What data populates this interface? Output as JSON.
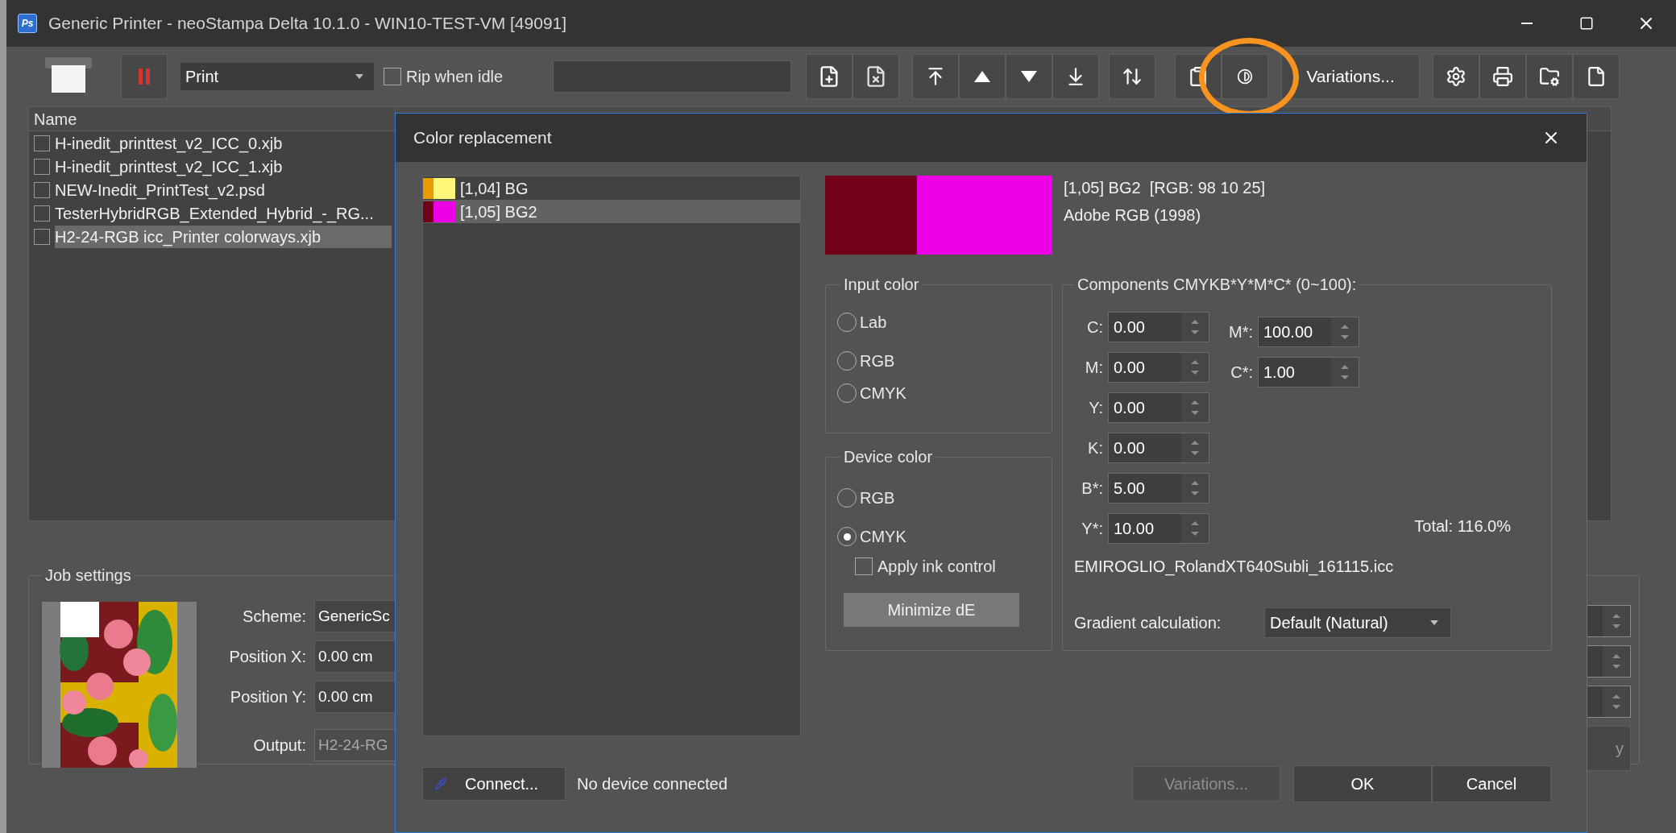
{
  "window": {
    "app_icon_text": "Ps",
    "title": "Generic Printer - neoStampa Delta 10.1.0 - WIN10-TEST-VM [49091]"
  },
  "toolbar": {
    "mode": {
      "value": "Print"
    },
    "rip_when_idle": {
      "label": "Rip when idle",
      "checked": false
    },
    "variations_button": "Variations..."
  },
  "job_list": {
    "columns": [
      "Name"
    ],
    "rows": [
      {
        "name": "H-inedit_printtest_v2_ICC_0.xjb",
        "checked": false,
        "selected": false
      },
      {
        "name": "H-inedit_printtest_v2_ICC_1.xjb",
        "checked": false,
        "selected": false
      },
      {
        "name": "NEW-Inedit_PrintTest_v2.psd",
        "checked": false,
        "selected": false
      },
      {
        "name": "TesterHybridRGB_Extended_Hybrid_-_RG...",
        "checked": false,
        "selected": false
      },
      {
        "name": "H2-24-RGB icc_Printer colorways.xjb",
        "checked": false,
        "selected": true
      }
    ]
  },
  "job_settings": {
    "title": "Job settings",
    "fields": [
      {
        "label": "Scheme:",
        "value": "GenericSc",
        "disabled": false
      },
      {
        "label": "Position X:",
        "value": "0.00 cm",
        "disabled": false
      },
      {
        "label": "Position Y:",
        "value": "0.00 cm",
        "disabled": false
      },
      {
        "label": "Output:",
        "value": "H2-24-RG",
        "disabled": true
      }
    ],
    "side_button": "y"
  },
  "dialog": {
    "title": "Color replacement",
    "colors": [
      {
        "label": "[1,04] BG",
        "swatches": [
          {
            "color": "#e89a00"
          },
          {
            "color": "#fff67a"
          }
        ],
        "selected": false
      },
      {
        "label": "[1,05] BG2",
        "swatches": [
          {
            "color": "#720018"
          },
          {
            "color": "#ee00e6"
          }
        ],
        "selected": true
      }
    ],
    "preview": {
      "swatches": [
        {
          "color": "#720018"
        },
        {
          "color": "#ee00e6"
        }
      ],
      "name": "[1,05] BG2  [RGB: 98 10 25]",
      "profile": "Adobe RGB (1998)"
    },
    "input_color": {
      "title": "Input color",
      "options": [
        {
          "label": "Lab",
          "selected": false
        },
        {
          "label": "RGB",
          "selected": false
        },
        {
          "label": "CMYK",
          "selected": false
        }
      ]
    },
    "device_color": {
      "title": "Device color",
      "options": [
        {
          "label": "RGB",
          "selected": false
        },
        {
          "label": "CMYK",
          "selected": true
        }
      ],
      "apply_ink_control": {
        "label": "Apply ink control",
        "checked": false
      },
      "minimize_button": "Minimize dE"
    },
    "components": {
      "title": "Components CMYKB*Y*M*C* (0~100):",
      "left": [
        {
          "label": "C:",
          "value": "0.00"
        },
        {
          "label": "M:",
          "value": "0.00"
        },
        {
          "label": "Y:",
          "value": "0.00"
        },
        {
          "label": "K:",
          "value": "0.00"
        },
        {
          "label": "B*:",
          "value": "5.00"
        },
        {
          "label": "Y*:",
          "value": "10.00"
        }
      ],
      "right": [
        {
          "label": "M*:",
          "value": "100.00"
        },
        {
          "label": "C*:",
          "value": "1.00"
        }
      ],
      "total": "Total: 116.0%",
      "profile": "EMIROGLIO_RolandXT640Subli_161115.icc",
      "gradient": {
        "label": "Gradient calculation:",
        "value": "Default (Natural)"
      }
    },
    "footer": {
      "connect_button": "Connect...",
      "status": "No device connected",
      "variations_button": {
        "label": "Variations...",
        "disabled": true
      },
      "ok_button": "OK",
      "cancel_button": "Cancel"
    }
  }
}
